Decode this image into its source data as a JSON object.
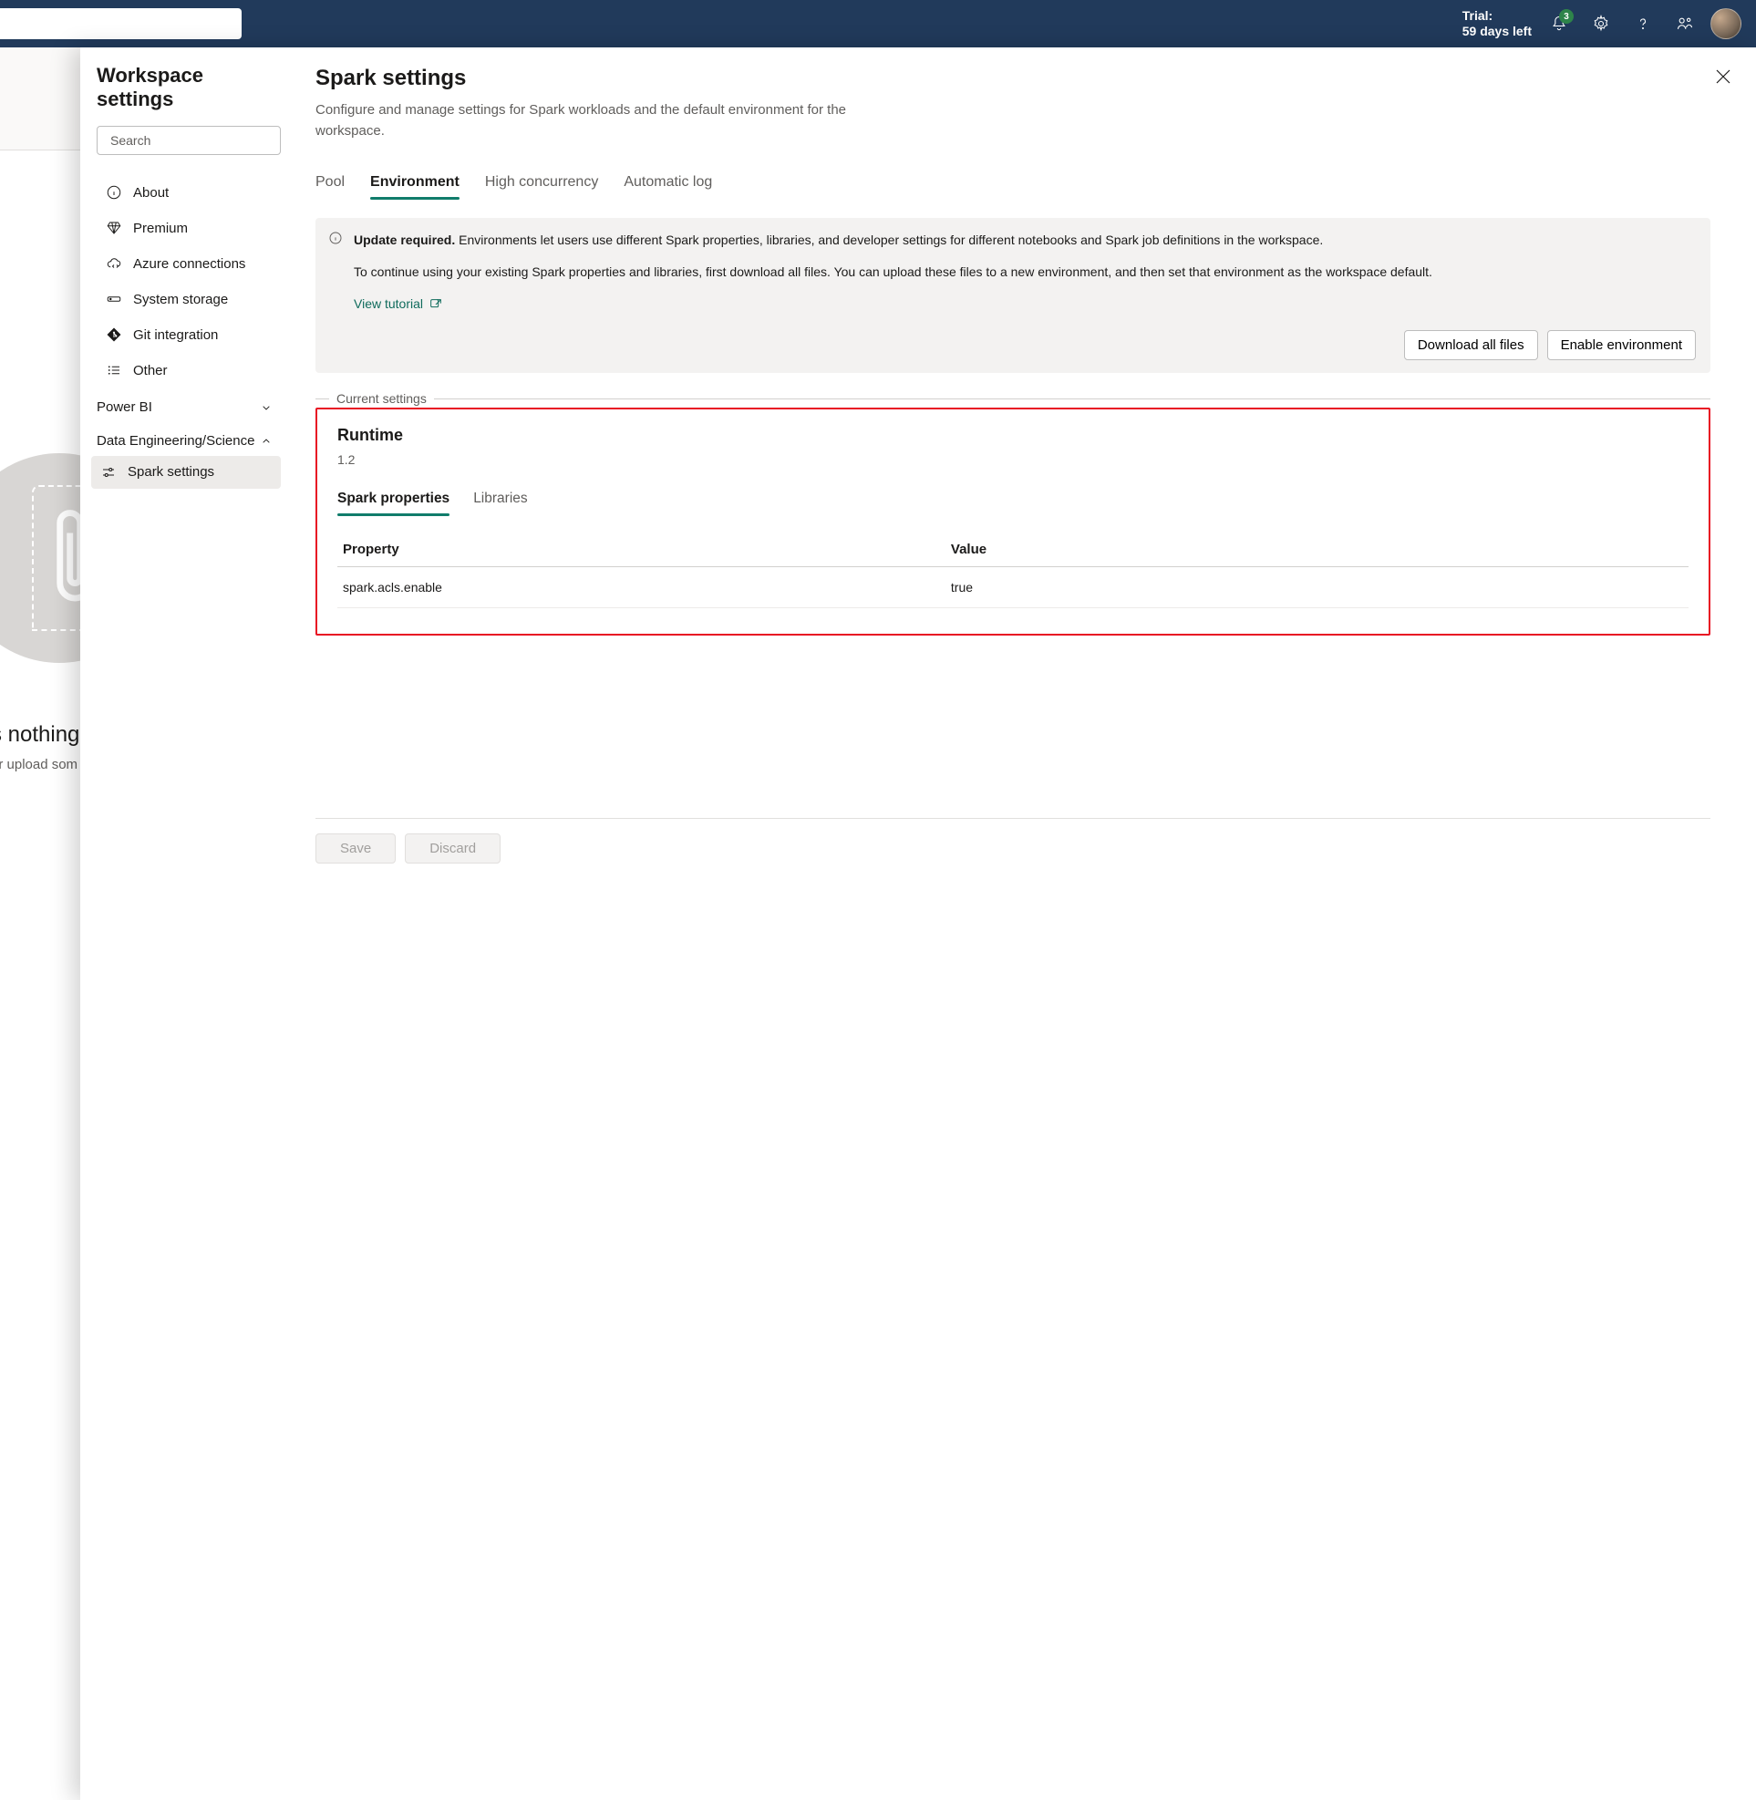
{
  "header": {
    "trial_line1": "Trial:",
    "trial_line2": "59 days left",
    "notification_count": "3"
  },
  "background": {
    "empty_title_fragment": "s nothing",
    "empty_sub_fragment": "or upload som"
  },
  "panel": {
    "title": "Workspace settings",
    "search_placeholder": "Search"
  },
  "sidebar": {
    "items": [
      {
        "label": "About"
      },
      {
        "label": "Premium"
      },
      {
        "label": "Azure connections"
      },
      {
        "label": "System storage"
      },
      {
        "label": "Git integration"
      },
      {
        "label": "Other"
      }
    ],
    "group_powerbi": "Power BI",
    "group_de": "Data Engineering/Science",
    "spark_settings": "Spark settings"
  },
  "main": {
    "title": "Spark settings",
    "description": "Configure and manage settings for Spark workloads and the default environment for the workspace.",
    "tabs": {
      "pool": "Pool",
      "environment": "Environment",
      "high_concurrency": "High concurrency",
      "automatic_log": "Automatic log"
    },
    "banner": {
      "strong": "Update required.",
      "p1_rest": " Environments let users use different Spark properties, libraries, and developer settings for different notebooks and Spark job definitions in the workspace.",
      "p2": "To continue using your existing Spark properties and libraries, first download all files. You can upload these files to a new environment, and then set that environment as the workspace default.",
      "link": "View tutorial",
      "btn_download": "Download all files",
      "btn_enable": "Enable environment"
    },
    "current_settings_legend": "Current settings",
    "runtime": {
      "title": "Runtime",
      "version": "1.2",
      "subtabs": {
        "spark_props": "Spark properties",
        "libraries": "Libraries"
      },
      "table": {
        "col_property": "Property",
        "col_value": "Value",
        "rows": [
          {
            "property": "spark.acls.enable",
            "value": "true"
          }
        ]
      }
    },
    "footer": {
      "save": "Save",
      "discard": "Discard"
    }
  }
}
